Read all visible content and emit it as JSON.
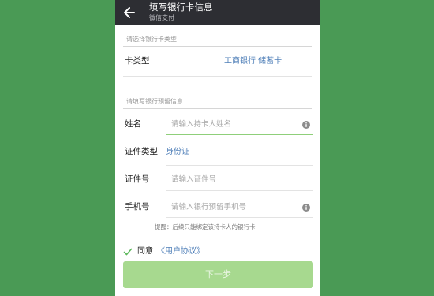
{
  "header": {
    "title": "填写银行卡信息",
    "subtitle": "微信支付"
  },
  "card_section": {
    "hint": "请选择银行卡类型",
    "card_type_label": "卡类型",
    "card_type_value": "工商银行 储蓄卡"
  },
  "info_section": {
    "hint": "请填写银行预留信息",
    "name_label": "姓名",
    "name_placeholder": "请输入持卡人姓名",
    "id_type_label": "证件类型",
    "id_type_value": "身份证",
    "id_number_label": "证件号",
    "id_number_placeholder": "请输入证件号",
    "phone_label": "手机号",
    "phone_placeholder": "请输入银行预留手机号"
  },
  "tip": "提醒：后续只能绑定该持卡人的银行卡",
  "agreement": {
    "agree_text": "同意",
    "link_text": "《用户协议》",
    "checked": true
  },
  "next_button_label": "下一步",
  "colors": {
    "background": "#4a9a55",
    "appbar": "#2d2e33",
    "link": "#4f7fb8",
    "button": "#a7d98f",
    "focus_line": "#8fcf7a"
  },
  "icons": {
    "back": "back-arrow-icon",
    "info": "info-icon",
    "check": "checkmark-icon"
  }
}
